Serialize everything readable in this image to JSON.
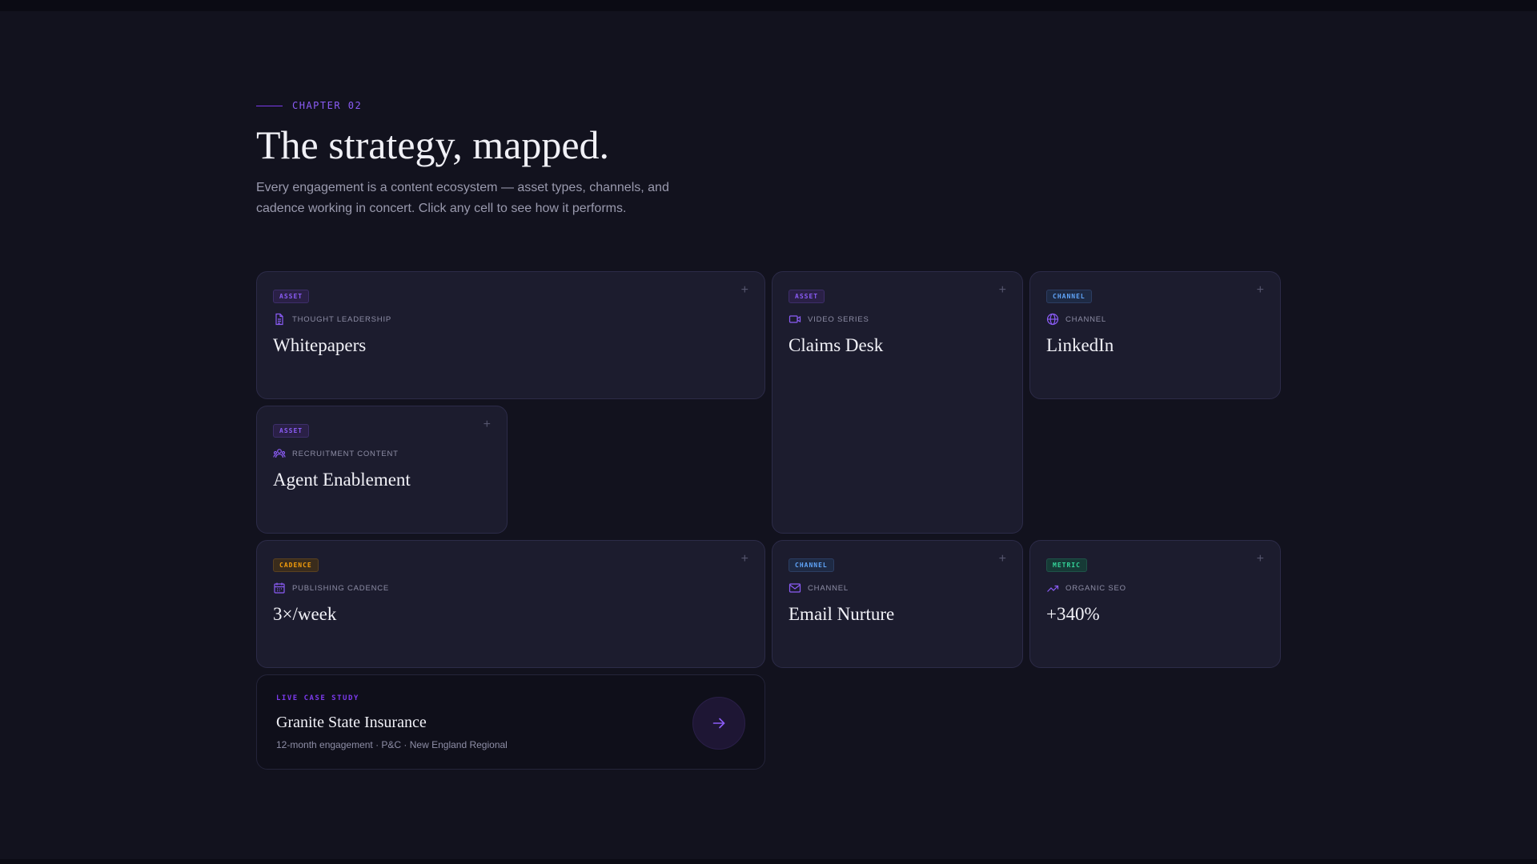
{
  "header": {
    "eyebrow": "CHAPTER 02",
    "title": "The strategy, mapped.",
    "subtitle": "Every engagement is a content ecosystem — asset types, channels, and cadence working in concert. Click any cell to see how it performs."
  },
  "cards": [
    {
      "badge": "ASSET",
      "kind": "asset",
      "icon": "document-icon",
      "label": "THOUGHT LEADERSHIP",
      "title": "Whitepapers"
    },
    {
      "badge": "ASSET",
      "kind": "asset",
      "icon": "video-icon",
      "label": "VIDEO SERIES",
      "title": "Claims Desk"
    },
    {
      "badge": "CHANNEL",
      "kind": "channel",
      "icon": "globe-icon",
      "label": "CHANNEL",
      "title": "LinkedIn"
    },
    {
      "badge": "ASSET",
      "kind": "asset",
      "icon": "people-icon",
      "label": "RECRUITMENT CONTENT",
      "title": "Agent Enablement"
    },
    {
      "badge": "CADENCE",
      "kind": "cadence",
      "icon": "calendar-icon",
      "label": "PUBLISHING CADENCE",
      "title": "3×/week"
    },
    {
      "badge": "CHANNEL",
      "kind": "channel",
      "icon": "mail-icon",
      "label": "CHANNEL",
      "title": "Email Nurture"
    },
    {
      "badge": "METRIC",
      "kind": "metric",
      "icon": "trend-up-icon",
      "label": "ORGANIC SEO",
      "title": "+340%"
    }
  ],
  "plus_glyph": "+",
  "case_study": {
    "eyebrow": "LIVE CASE STUDY",
    "name": "Granite State Insurance",
    "desc": "12-month engagement · P&C · New England Regional",
    "icon": "arrow-right-icon"
  },
  "colors": {
    "accent": "#8b5cf6",
    "background": "#12121e",
    "card": "#1c1c2e"
  }
}
